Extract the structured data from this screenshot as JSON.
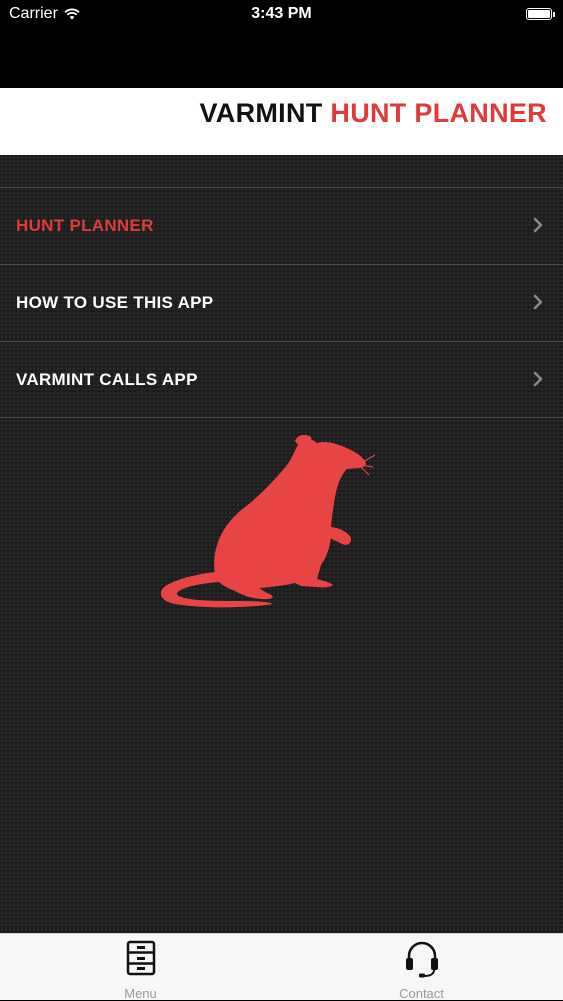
{
  "status_bar": {
    "carrier": "Carrier",
    "time": "3:43 PM"
  },
  "header": {
    "title_part1": "VARMINT",
    "title_part2": "HUNT PLANNER"
  },
  "menu": {
    "items": [
      {
        "label": "HUNT PLANNER",
        "active": true
      },
      {
        "label": "HOW TO USE THIS APP",
        "active": false
      },
      {
        "label": "VARMINT CALLS APP",
        "active": false
      }
    ]
  },
  "colors": {
    "accent": "#e03b3b",
    "header_bg": "#ffffff",
    "menu_bg": "#1e1e1e",
    "tab_bar_bg": "#f7f7f7"
  },
  "tab_bar": {
    "tabs": [
      {
        "label": "Menu",
        "icon": "drawer-cabinet-icon"
      },
      {
        "label": "Contact",
        "icon": "headset-icon"
      }
    ]
  }
}
